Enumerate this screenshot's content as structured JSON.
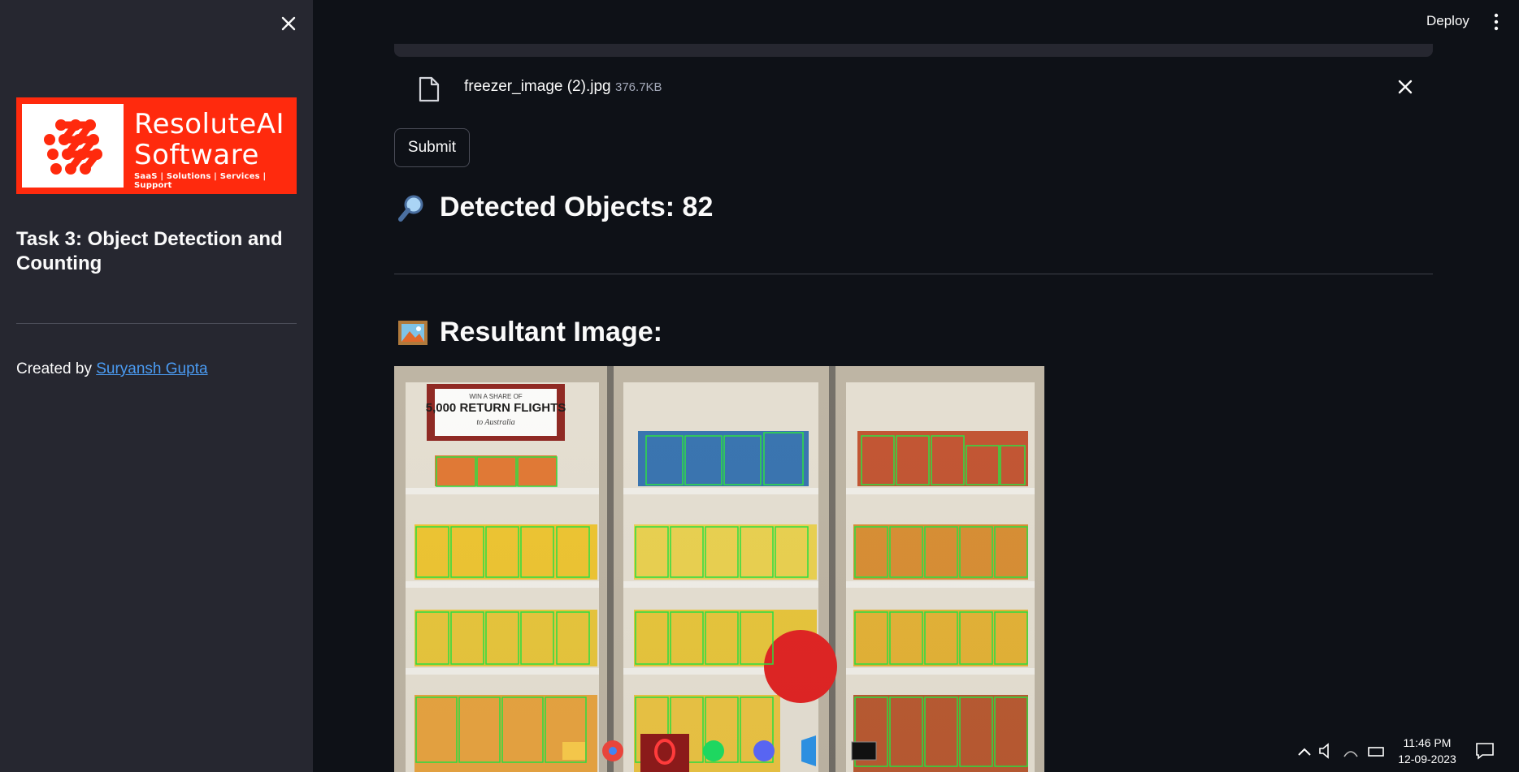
{
  "sidebar": {
    "logo": {
      "brand_line1": "ResoluteAI",
      "brand_line2": "Software",
      "tagline": "SaaS | Solutions | Services | Support"
    },
    "title": "Task 3: Object Detection and Counting",
    "credit_prefix": "Created by ",
    "credit_link": "Suryansh Gupta"
  },
  "header": {
    "deploy_label": "Deploy"
  },
  "upload": {
    "file_name": "freezer_image (2).jpg",
    "file_size": "376.7KB"
  },
  "submit_label": "Submit",
  "result": {
    "detected_heading": "Detected Objects: 82",
    "resultant_heading": "Resultant Image:",
    "poster_text_top": "WIN A SHARE OF",
    "poster_text_main": "5,000 RETURN FLIGHTS",
    "poster_text_sub": "to Australia"
  },
  "taskbar": {
    "time": "11:46 PM",
    "date": "12-09-2023"
  },
  "colors": {
    "sidebar_bg": "#262730",
    "main_bg": "#0e1117",
    "link": "#4a9bf2",
    "logo_bg": "#ff2a0d",
    "detection_box": "#22e33a"
  }
}
